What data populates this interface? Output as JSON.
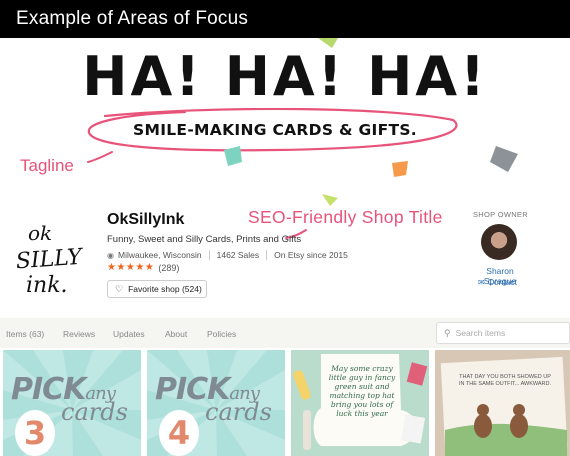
{
  "header": {
    "title": "Example of Areas of Focus"
  },
  "banner": {
    "headline": "HA! HA! HA!",
    "tagline": "SMILE-MAKING CARDS & GIFTS."
  },
  "annotations": {
    "tagline": "Tagline",
    "seo_title": "SEO-Friendly Shop Title"
  },
  "shop": {
    "name": "OkSillyInk",
    "description": "Funny, Sweet and Silly Cards, Prints and Gifts",
    "location": "Milwaukee, Wisconsin",
    "sales": "1462 Sales",
    "since": "On Etsy since 2015",
    "rating_stars": 5,
    "review_count": "(289)",
    "favorite_label": "Favorite shop (524)",
    "logo_lines": [
      "ok",
      "SILLY",
      "ink."
    ]
  },
  "owner": {
    "label": "SHOP OWNER",
    "name": "Sharon Sprague",
    "contact": "Contact"
  },
  "tabs": [
    "Items (63)",
    "Reviews",
    "Updates",
    "About",
    "Policies"
  ],
  "search": {
    "placeholder": "Search items"
  },
  "listings": [
    {
      "pick": "PICK",
      "any": "any",
      "number": "3",
      "cards": "cards"
    },
    {
      "pick": "PICK",
      "any": "any",
      "number": "4",
      "cards": "cards"
    },
    {
      "card_text": "May some crazy little guy in fancy green suit and matching top hat bring you lots of luck this year",
      "bg": "#b9dccd"
    },
    {
      "card_text": "THAT DAY YOU BOTH SHOWED UP IN THE SAME OUTFIT... AWKWARD.",
      "bg": "#f2ece6"
    }
  ],
  "colors": {
    "annotation": "#e8537a",
    "accent_orange": "#f1641e",
    "link_blue": "#2b6cb0",
    "teal": "#bfe7e3"
  }
}
